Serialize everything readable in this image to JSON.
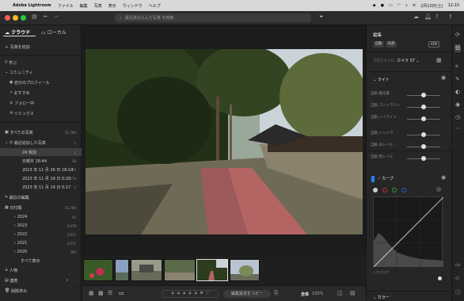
{
  "menubar": {
    "app": "Adobe Lightroom",
    "items": [
      "ファイル",
      "編集",
      "写真",
      "表示",
      "ウィンドウ",
      "ヘルプ"
    ],
    "datetime": "2月10日(土)",
    "time": "12:10"
  },
  "toolbar": {
    "search_placeholder": "最近読み込んだ写真 を検索"
  },
  "left": {
    "tabs": [
      "クラウド",
      "ローカル"
    ],
    "add_photos": "写真を追加",
    "learn": "学ぶ",
    "community": "コミュニティ",
    "community_items": [
      "自分のプロフィール",
      "おすすめ",
      "フォロー中",
      "リミックス"
    ],
    "all_photos": "すべての写真",
    "all_photos_count": "21,789",
    "recent": "最近追加した写真",
    "recent_count": "1",
    "recent_items": [
      {
        "label": "24 枚前",
        "count": "1"
      },
      {
        "label": "日曜日 18:44",
        "count": "38"
      },
      {
        "label": "2023 年 11 月 26 日 18:14",
        "count": "274"
      },
      {
        "label": "2023 年 11 月 19 日 0:20",
        "count": "174"
      },
      {
        "label": "2023 年 11 月 19 日 0:17",
        "count": "1"
      }
    ],
    "recent_edits": "最近の編集",
    "by_date": "日付順",
    "by_date_count": "21,789",
    "years": [
      {
        "label": "2024",
        "count": "45"
      },
      {
        "label": "2023",
        "count": "4,079"
      },
      {
        "label": "2022",
        "count": "3,911"
      },
      {
        "label": "2021",
        "count": "4,071"
      },
      {
        "label": "2020",
        "count": "304"
      }
    ],
    "show_all": "すべて表示",
    "people": "人物",
    "albums": "連携",
    "deleted": "削除済み"
  },
  "right": {
    "title": "編集",
    "chips": [
      "自動",
      "白黒"
    ],
    "hdr": "HDR",
    "profile_label": "プロファイル",
    "profile_value": "カメラ ST",
    "light": "ライト",
    "light_sliders": [
      {
        "label": "自動 露光量",
        "value": 0.5
      },
      {
        "label": "自動 コントラスト",
        "value": 0.5
      },
      {
        "label": "自動 ハイライト",
        "value": 0.5
      },
      {
        "label": "自動 シャドウ",
        "value": 0.5
      },
      {
        "label": "自動 白レベル",
        "value": 0.5
      },
      {
        "label": "自動 黒レベル",
        "value": 0.5
      }
    ],
    "curve": "カーブ",
    "curve_channel_colors": [
      "#cccccc",
      "#d03030",
      "#30a030",
      "#3060d0"
    ],
    "curve_input_label": "入力と出力",
    "color": "カラー"
  },
  "bottom": {
    "copy_settings": "編集設定をコピー",
    "fit": "全体",
    "zoom": "100%"
  },
  "colors": {
    "accent": "#2680eb"
  }
}
